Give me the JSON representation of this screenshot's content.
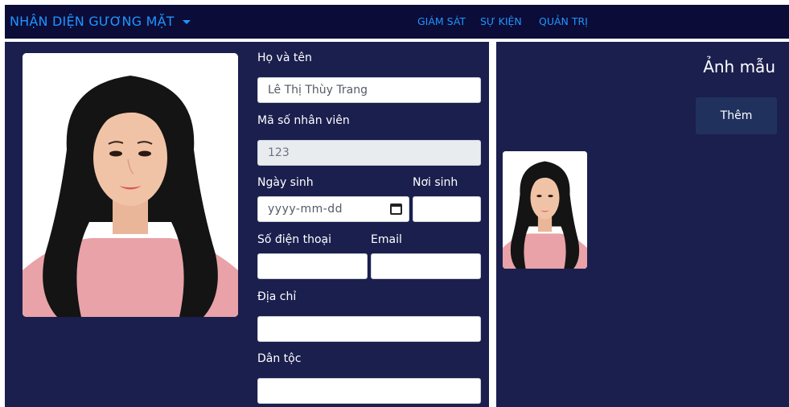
{
  "header": {
    "brand": "NHẬN DIỆN GƯƠNG MẶT",
    "nav": [
      "GIÁM SÁT",
      "SỰ KIỆN",
      "QUẢN TRỊ"
    ]
  },
  "form": {
    "full_name_label": "Họ và tên",
    "full_name_value": "Lê Thị Thùy Trang",
    "employee_id_label": "Mã số nhân viên",
    "employee_id_value": "123",
    "dob_label": "Ngày sinh",
    "dob_placeholder": "yyyy-mm-dd",
    "birthplace_label": "Nơi sinh",
    "birthplace_value": "",
    "phone_label": "Số điện thoại",
    "phone_value": "",
    "email_label": "Email",
    "email_value": "",
    "address_label": "Địa chỉ",
    "address_value": "",
    "ethnicity_label": "Dân tộc",
    "ethnicity_value": ""
  },
  "samples": {
    "title": "Ảnh mẫu",
    "add_label": "Thêm"
  },
  "colors": {
    "topbar": "#0b0c38",
    "panel": "#1b1f4e",
    "accent": "#1e96ff",
    "button": "#21315e"
  }
}
